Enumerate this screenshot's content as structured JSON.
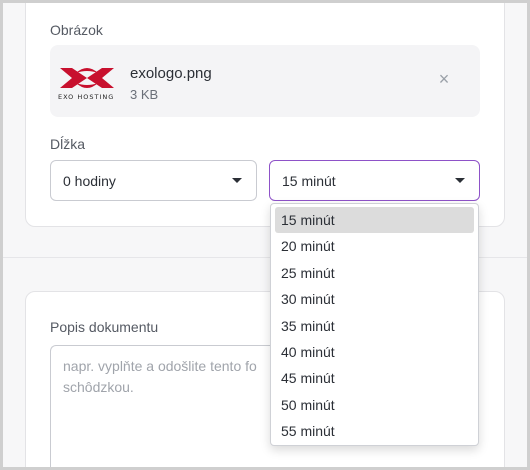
{
  "image_section": {
    "label": "Obrázok",
    "file": {
      "logo_text": "EXO HOSTING",
      "name": "exologo.png",
      "size": "3 KB",
      "remove_icon": "close-icon"
    }
  },
  "duration_section": {
    "label": "Dĺžka",
    "hours_select": {
      "value": "0 hodiny"
    },
    "minutes_select": {
      "value": "15 minút",
      "options": [
        "15 minút",
        "20 minút",
        "25 minút",
        "30 minút",
        "35 minút",
        "40 minút",
        "45 minút",
        "50 minút",
        "55 minút"
      ],
      "selected_index": 0
    }
  },
  "description_section": {
    "label": "Popis dokumentu",
    "placeholder_line1": "napr. vyplňte a odošlite tento fo",
    "placeholder_line2": "schôdzkou."
  },
  "colors": {
    "accent": "#8e52c8",
    "logo_red": "#c8102e"
  }
}
